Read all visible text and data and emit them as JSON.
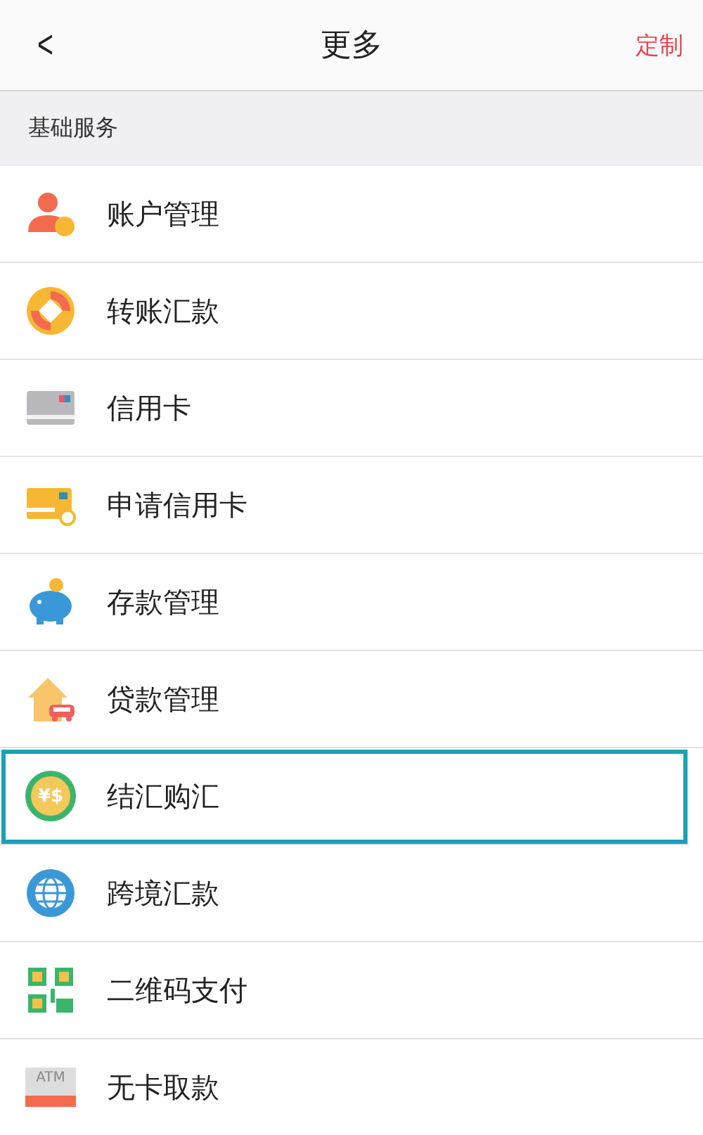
{
  "header": {
    "back": "<",
    "title": "更多",
    "action": "定制"
  },
  "section": {
    "title": "基础服务"
  },
  "items": [
    {
      "label": "账户管理",
      "selected": false
    },
    {
      "label": "转账汇款",
      "selected": false
    },
    {
      "label": "信用卡",
      "selected": false
    },
    {
      "label": "申请信用卡",
      "selected": false
    },
    {
      "label": "存款管理",
      "selected": false
    },
    {
      "label": "贷款管理",
      "selected": false
    },
    {
      "label": "结汇购汇",
      "icon_text": "¥$",
      "selected": true
    },
    {
      "label": "跨境汇款",
      "selected": false
    },
    {
      "label": "二维码支付",
      "selected": false
    },
    {
      "label": "无卡取款",
      "icon_text": "ATM",
      "selected": false
    }
  ]
}
